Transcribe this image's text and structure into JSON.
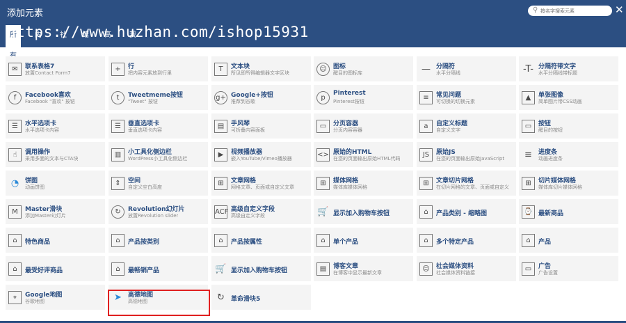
{
  "header": {
    "title": "添加元素",
    "search_placeholder": "按名字搜索元素",
    "close_glyph": "✕",
    "watermark": "https://www.huzhan.com/ishop15931"
  },
  "tabs": [
    "所有",
    "内容",
    "社交",
    "结构",
    "高级",
    "我的"
  ],
  "colors": {
    "header_bg": "#2c4f82",
    "item_bg": "#f4f4f4",
    "name_text": "#2c4f82",
    "highlight_border": "#e02020"
  },
  "items": [
    {
      "name": "联系表格7",
      "desc": "放置Contact Form7",
      "icon": "contact-form-icon"
    },
    {
      "name": "行",
      "desc": "把内容元素放到行里",
      "icon": "row-icon"
    },
    {
      "name": "文本块",
      "desc": "所见即所得编辑器文字区块",
      "icon": "text-block-icon"
    },
    {
      "name": "图标",
      "desc": "醒目的图标库",
      "icon": "smiley-icon"
    },
    {
      "name": "分隔符",
      "desc": "水平分隔线",
      "icon": "separator-icon"
    },
    {
      "name": "分隔符带文字",
      "desc": "水平分隔线带标题",
      "icon": "separator-text-icon"
    },
    {
      "name": "Facebook喜欢",
      "desc": "Facebook \"喜欢\" 按钮",
      "icon": "facebook-icon"
    },
    {
      "name": "Tweetmeme按钮",
      "desc": "\"Tweet\" 按钮",
      "icon": "twitter-icon"
    },
    {
      "name": "Google+按钮",
      "desc": "推荐到谷歌",
      "icon": "google-plus-icon"
    },
    {
      "name": "Pinterest",
      "desc": "Pinterest按钮",
      "icon": "pinterest-icon"
    },
    {
      "name": "常见问题",
      "desc": "可切换的切换元素",
      "icon": "faq-icon"
    },
    {
      "name": "单张图像",
      "desc": "简单图片带CSS动画",
      "icon": "image-icon"
    },
    {
      "name": "水平选项卡",
      "desc": "水平选项卡内容",
      "icon": "tabs-icon"
    },
    {
      "name": "垂直选项卡",
      "desc": "垂直选项卡内容",
      "icon": "vertical-tabs-icon"
    },
    {
      "name": "手风琴",
      "desc": "可折叠内容面板",
      "icon": "accordion-icon"
    },
    {
      "name": "分页容器",
      "desc": "分页内容容器",
      "icon": "pageable-icon"
    },
    {
      "name": "自定义标题",
      "desc": "自定义文字",
      "icon": "custom-heading-icon"
    },
    {
      "name": "按钮",
      "desc": "醒目的按钮",
      "icon": "button-icon"
    },
    {
      "name": "调用操作",
      "desc": "采用多面的文本与CTA块",
      "icon": "cta-icon"
    },
    {
      "name": "小工具化侧边栏",
      "desc": "WordPress小工具化侧边栏",
      "icon": "sidebar-icon"
    },
    {
      "name": "视频播放器",
      "desc": "嵌入YouTube/Vimeo播放器",
      "icon": "video-icon"
    },
    {
      "name": "原始的HTML",
      "desc": "在您的页面输出原始HTML代码",
      "icon": "html-icon"
    },
    {
      "name": "原始JS",
      "desc": "在您的页面输出原始JavaScript",
      "icon": "js-icon"
    },
    {
      "name": "进度条",
      "desc": "动画进度条",
      "icon": "progress-icon"
    },
    {
      "name": "饼图",
      "desc": "动画饼图",
      "icon": "pie-icon"
    },
    {
      "name": "空间",
      "desc": "自定义空白高度",
      "icon": "space-icon"
    },
    {
      "name": "文章网格",
      "desc": "网格文章、页面或自定义文章",
      "icon": "post-grid-icon"
    },
    {
      "name": "媒体网格",
      "desc": "媒体库媒体网格",
      "icon": "media-grid-icon"
    },
    {
      "name": "文章切片网格",
      "desc": "在切片网格的文章、页面或自定义",
      "icon": "masonry-grid-icon"
    },
    {
      "name": "切片媒体网格",
      "desc": "媒体库切片媒体网格",
      "icon": "masonry-media-icon"
    },
    {
      "name": "Master滑块",
      "desc": "添加Master幻灯片",
      "icon": "master-slider-icon"
    },
    {
      "name": "Revolution幻灯片",
      "desc": "放置Revolution slider",
      "icon": "revolution-icon"
    },
    {
      "name": "高级自定义字段",
      "desc": "高级自定义字段",
      "icon": "acf-icon"
    },
    {
      "name": "显示加入购物车按钮",
      "desc": "",
      "icon": "cart-icon"
    },
    {
      "name": "产品类别 - 缩略图",
      "desc": "",
      "icon": "category-icon"
    },
    {
      "name": "最新商品",
      "desc": "",
      "icon": "recent-icon"
    },
    {
      "name": "特色商品",
      "desc": "",
      "icon": "store-icon"
    },
    {
      "name": "产品按类别",
      "desc": "",
      "icon": "store-icon"
    },
    {
      "name": "产品按属性",
      "desc": "",
      "icon": "store-icon"
    },
    {
      "name": "单个产品",
      "desc": "",
      "icon": "store-icon"
    },
    {
      "name": "多个特定产品",
      "desc": "",
      "icon": "store-icon"
    },
    {
      "name": "产品",
      "desc": "",
      "icon": "store-icon"
    },
    {
      "name": "最受好评商品",
      "desc": "",
      "icon": "store-icon"
    },
    {
      "name": "最畅销产品",
      "desc": "",
      "icon": "store-icon"
    },
    {
      "name": "显示加入购物车按钮",
      "desc": "",
      "icon": "cart-icon"
    },
    {
      "name": "博客文章",
      "desc": "在博客中显示最新文章",
      "icon": "blog-icon"
    },
    {
      "name": "社会媒体资料",
      "desc": "社会媒体资料链接",
      "icon": "social-icon"
    },
    {
      "name": "广告",
      "desc": "广告设置",
      "icon": "ad-icon"
    },
    {
      "name": "Google地图",
      "desc": "谷歌地图",
      "icon": "map-icon"
    },
    {
      "name": "高德地图",
      "desc": "高德地图",
      "icon": "amap-icon"
    },
    {
      "name": "革命滑块5",
      "desc": "",
      "icon": "refresh-icon"
    }
  ]
}
